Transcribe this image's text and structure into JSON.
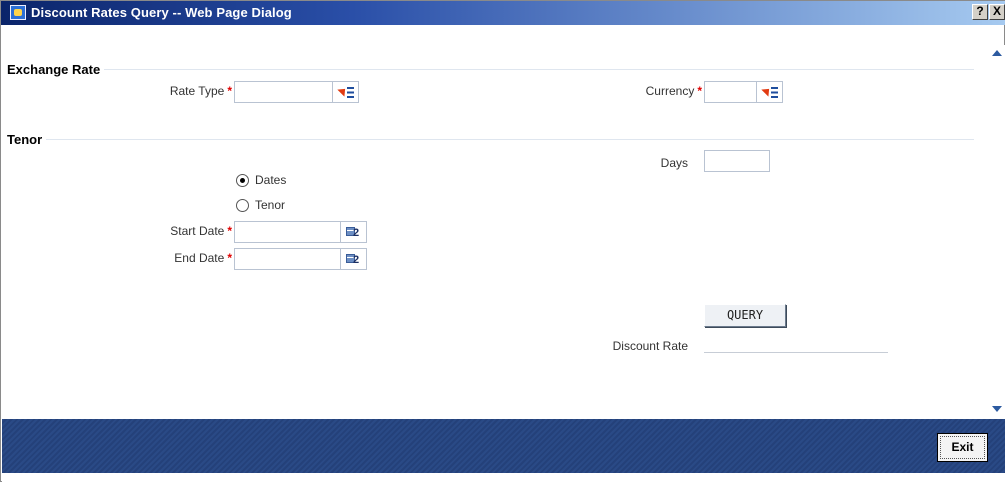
{
  "window": {
    "title": "Discount Rates Query -- Web Page Dialog",
    "help_label": "?",
    "close_label": "X"
  },
  "exchange_rate": {
    "section_label": "Exchange Rate",
    "rate_type_label": "Rate Type",
    "rate_type_value": "",
    "currency_label": "Currency",
    "currency_value": "",
    "required_mark": "*"
  },
  "tenor": {
    "section_label": "Tenor",
    "days_label": "Days",
    "days_value": "",
    "options": [
      {
        "label": "Dates",
        "selected": true
      },
      {
        "label": "Tenor",
        "selected": false
      }
    ],
    "start_date_label": "Start Date",
    "start_date_value": "",
    "end_date_label": "End Date",
    "end_date_value": "",
    "required_mark": "*",
    "calendar_digit": "2"
  },
  "query": {
    "button_label": "QUERY",
    "discount_rate_label": "Discount Rate",
    "discount_rate_value": ""
  },
  "footer": {
    "exit_label": "Exit"
  },
  "icons": {
    "lov": "list-of-values-icon",
    "calendar": "calendar-icon",
    "app": "ie-dialog-icon"
  }
}
